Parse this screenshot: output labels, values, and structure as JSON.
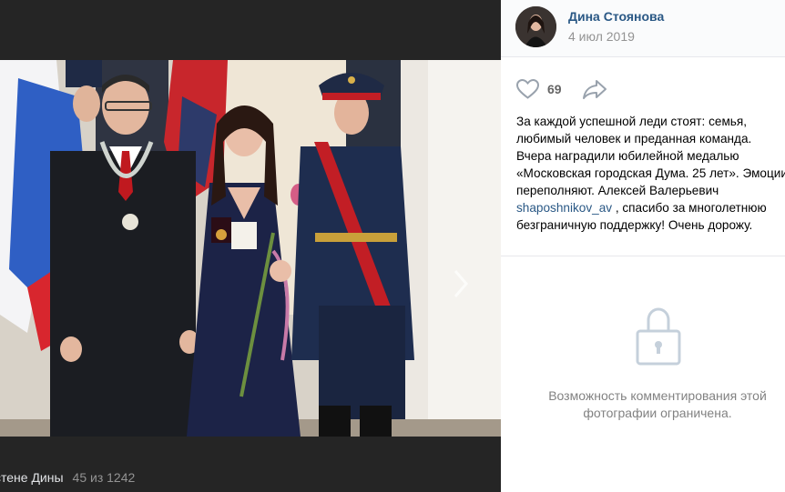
{
  "viewer": {
    "album_label": "стене Дины",
    "counter": "45 из 1242"
  },
  "post": {
    "author": "Дина Стоянова",
    "date": "4 июл 2019",
    "likes": "69",
    "text_before": "За каждой успешной леди стоят: семья, любимый человек и преданная команда. Вчера наградили юбилейной медалью «Московская городская Дума. 25 лет». Эмоции переполняют. Алексей Валерьевич ",
    "mention": "shaposhnikov_av",
    "text_after": " , спасибо за многолетнюю безграничную поддержку! Очень дорожу."
  },
  "comments": {
    "restricted_text": "Возможность комментирования этой фотографии ограничена."
  },
  "icons": {
    "like": "heart-outline-icon",
    "share": "share-arrow-icon",
    "lock": "lock-icon",
    "next": "chevron-right-icon"
  },
  "colors": {
    "link": "#2a5885",
    "viewer_bg": "#252525",
    "muted": "#939393"
  }
}
